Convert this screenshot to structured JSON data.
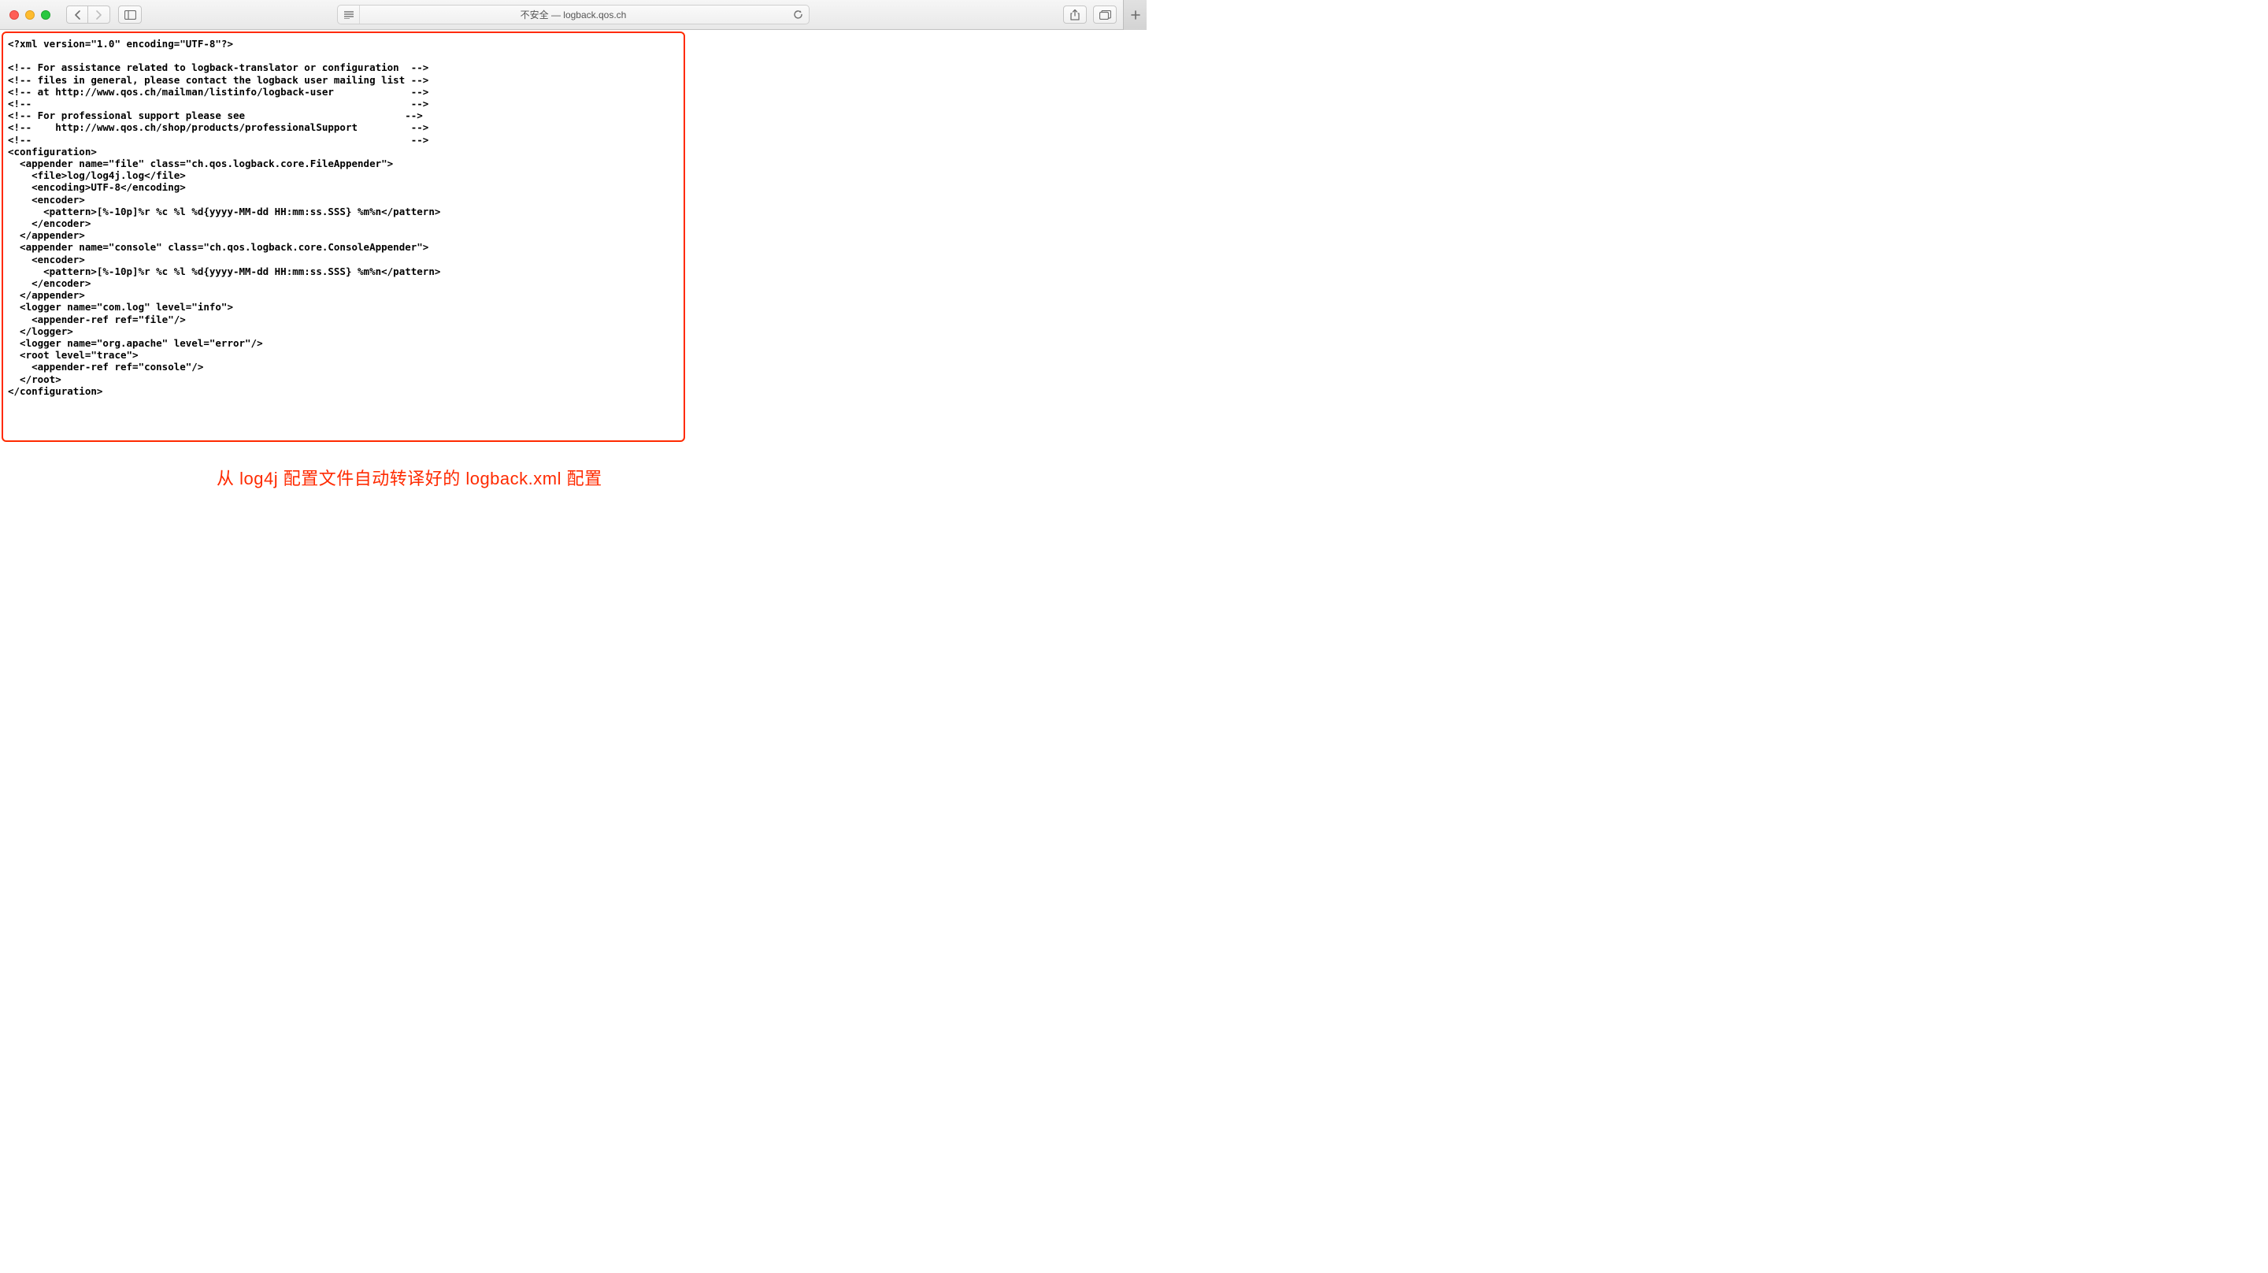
{
  "address_bar": {
    "insecure_label": "不安全 — ",
    "host": "logback.qos.ch"
  },
  "annotation_caption": "从 log4j 配置文件自动转译好的 logback.xml 配置",
  "code_lines": [
    "<?xml version=\"1.0\" encoding=\"UTF-8\"?>",
    "",
    "<!-- For assistance related to logback-translator or configuration  -->",
    "<!-- files in general, please contact the logback user mailing list -->",
    "<!-- at http://www.qos.ch/mailman/listinfo/logback-user             -->",
    "<!--                                                                -->",
    "<!-- For professional support please see                           -->",
    "<!--    http://www.qos.ch/shop/products/professionalSupport         -->",
    "<!--                                                                -->",
    "<configuration>",
    "  <appender name=\"file\" class=\"ch.qos.logback.core.FileAppender\">",
    "    <file>log/log4j.log</file>",
    "    <encoding>UTF-8</encoding>",
    "    <encoder>",
    "      <pattern>[%-10p]%r %c %l %d{yyyy-MM-dd HH:mm:ss.SSS} %m%n</pattern>",
    "    </encoder>",
    "  </appender>",
    "  <appender name=\"console\" class=\"ch.qos.logback.core.ConsoleAppender\">",
    "    <encoder>",
    "      <pattern>[%-10p]%r %c %l %d{yyyy-MM-dd HH:mm:ss.SSS} %m%n</pattern>",
    "    </encoder>",
    "  </appender>",
    "  <logger name=\"com.log\" level=\"info\">",
    "    <appender-ref ref=\"file\"/>",
    "  </logger>",
    "  <logger name=\"org.apache\" level=\"error\"/>",
    "  <root level=\"trace\">",
    "    <appender-ref ref=\"console\"/>",
    "  </root>",
    "</configuration>"
  ],
  "watermark": ""
}
